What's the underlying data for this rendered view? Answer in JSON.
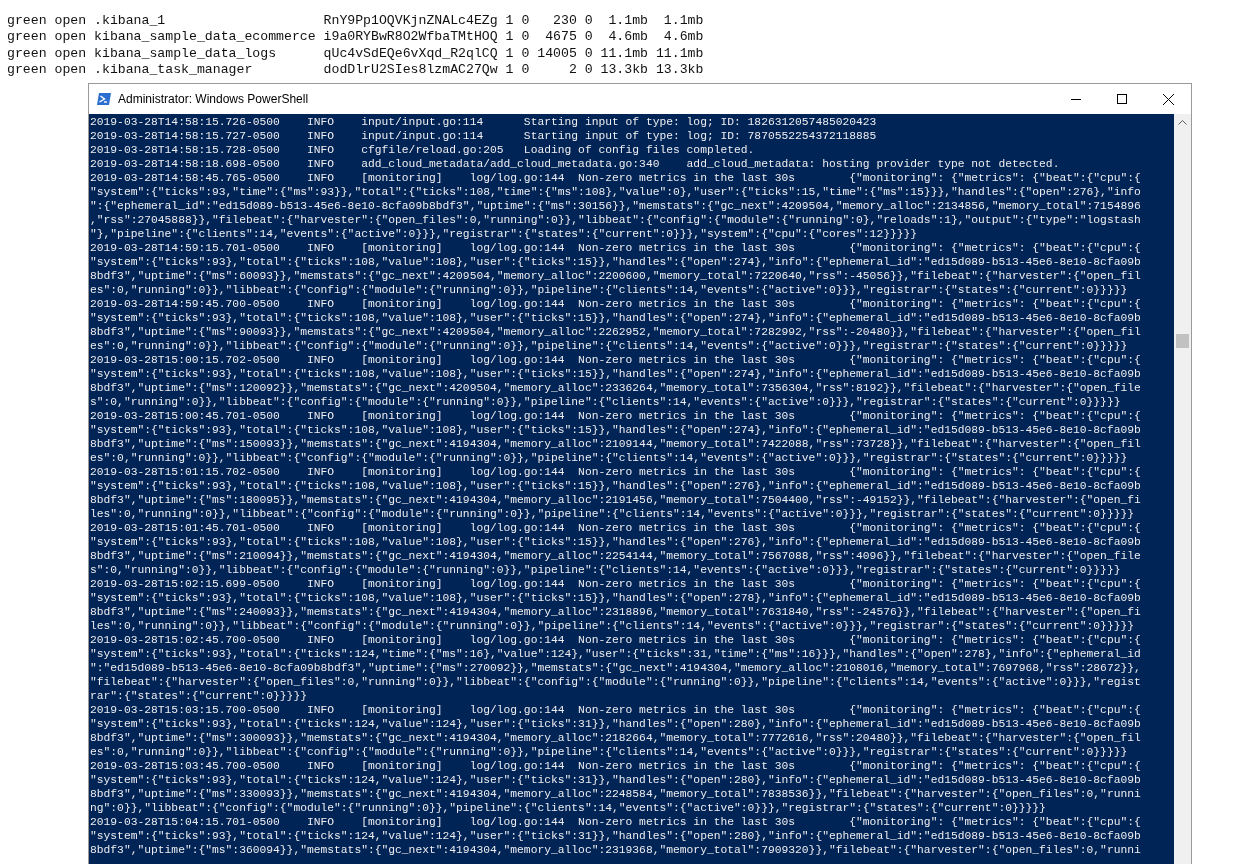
{
  "terminal_rows": [
    "green open .kibana_1                    RnY9Pp1OQVKjnZNALc4EZg 1 0   230 0  1.1mb  1.1mb",
    "green open kibana_sample_data_ecommerce i9a0RYBwR8O2WfbaTMtHOQ 1 0  4675 0  4.6mb  4.6mb",
    "green open kibana_sample_data_logs      qUc4vSdEQe6vXqd_R2qlCQ 1 0 14005 0 11.1mb 11.1mb",
    "green open .kibana_task_manager         dodDlrU2SIes8lzmAC27Qw 1 0     2 0 13.3kb 13.3kb"
  ],
  "window": {
    "title": "Administrator: Windows PowerShell"
  },
  "console_lines": [
    "2019-03-28T14:58:15.726-0500    INFO    input/input.go:114      Starting input of type: log; ID: 1826312057485020423",
    "2019-03-28T14:58:15.727-0500    INFO    input/input.go:114      Starting input of type: log; ID: 7870552254372118885",
    "2019-03-28T14:58:15.728-0500    INFO    cfgfile/reload.go:205   Loading of config files completed.",
    "2019-03-28T14:58:18.698-0500    INFO    add_cloud_metadata/add_cloud_metadata.go:340    add_cloud_metadata: hosting provider type not detected.",
    "2019-03-28T14:58:45.765-0500    INFO    [monitoring]    log/log.go:144  Non-zero metrics in the last 30s        {\"monitoring\": {\"metrics\": {\"beat\":{\"cpu\":{",
    "\"system\":{\"ticks\":93,\"time\":{\"ms\":93}},\"total\":{\"ticks\":108,\"time\":{\"ms\":108},\"value\":0},\"user\":{\"ticks\":15,\"time\":{\"ms\":15}}},\"handles\":{\"open\":276},\"info",
    "\":{\"ephemeral_id\":\"ed15d089-b513-45e6-8e10-8cfa09b8bdf3\",\"uptime\":{\"ms\":30156}},\"memstats\":{\"gc_next\":4209504,\"memory_alloc\":2134856,\"memory_total\":7154896",
    ",\"rss\":27045888}},\"filebeat\":{\"harvester\":{\"open_files\":0,\"running\":0}},\"libbeat\":{\"config\":{\"module\":{\"running\":0},\"reloads\":1},\"output\":{\"type\":\"logstash",
    "\"},\"pipeline\":{\"clients\":14,\"events\":{\"active\":0}}},\"registrar\":{\"states\":{\"current\":0}}},\"system\":{\"cpu\":{\"cores\":12}}}}}",
    "2019-03-28T14:59:15.701-0500    INFO    [monitoring]    log/log.go:144  Non-zero metrics in the last 30s        {\"monitoring\": {\"metrics\": {\"beat\":{\"cpu\":{",
    "\"system\":{\"ticks\":93},\"total\":{\"ticks\":108,\"value\":108},\"user\":{\"ticks\":15}},\"handles\":{\"open\":274},\"info\":{\"ephemeral_id\":\"ed15d089-b513-45e6-8e10-8cfa09b",
    "8bdf3\",\"uptime\":{\"ms\":60093}},\"memstats\":{\"gc_next\":4209504,\"memory_alloc\":2200600,\"memory_total\":7220640,\"rss\":-45056}},\"filebeat\":{\"harvester\":{\"open_fil",
    "es\":0,\"running\":0}},\"libbeat\":{\"config\":{\"module\":{\"running\":0}},\"pipeline\":{\"clients\":14,\"events\":{\"active\":0}}},\"registrar\":{\"states\":{\"current\":0}}}}}",
    "2019-03-28T14:59:45.700-0500    INFO    [monitoring]    log/log.go:144  Non-zero metrics in the last 30s        {\"monitoring\": {\"metrics\": {\"beat\":{\"cpu\":{",
    "\"system\":{\"ticks\":93},\"total\":{\"ticks\":108,\"value\":108},\"user\":{\"ticks\":15}},\"handles\":{\"open\":274},\"info\":{\"ephemeral_id\":\"ed15d089-b513-45e6-8e10-8cfa09b",
    "8bdf3\",\"uptime\":{\"ms\":90093}},\"memstats\":{\"gc_next\":4209504,\"memory_alloc\":2262952,\"memory_total\":7282992,\"rss\":-20480}},\"filebeat\":{\"harvester\":{\"open_fil",
    "es\":0,\"running\":0}},\"libbeat\":{\"config\":{\"module\":{\"running\":0}},\"pipeline\":{\"clients\":14,\"events\":{\"active\":0}}},\"registrar\":{\"states\":{\"current\":0}}}}}",
    "2019-03-28T15:00:15.702-0500    INFO    [monitoring]    log/log.go:144  Non-zero metrics in the last 30s        {\"monitoring\": {\"metrics\": {\"beat\":{\"cpu\":{",
    "\"system\":{\"ticks\":93},\"total\":{\"ticks\":108,\"value\":108},\"user\":{\"ticks\":15}},\"handles\":{\"open\":274},\"info\":{\"ephemeral_id\":\"ed15d089-b513-45e6-8e10-8cfa09b",
    "8bdf3\",\"uptime\":{\"ms\":120092}},\"memstats\":{\"gc_next\":4209504,\"memory_alloc\":2336264,\"memory_total\":7356304,\"rss\":8192}},\"filebeat\":{\"harvester\":{\"open_file",
    "s\":0,\"running\":0}},\"libbeat\":{\"config\":{\"module\":{\"running\":0}},\"pipeline\":{\"clients\":14,\"events\":{\"active\":0}}},\"registrar\":{\"states\":{\"current\":0}}}}}",
    "2019-03-28T15:00:45.701-0500    INFO    [monitoring]    log/log.go:144  Non-zero metrics in the last 30s        {\"monitoring\": {\"metrics\": {\"beat\":{\"cpu\":{",
    "\"system\":{\"ticks\":93},\"total\":{\"ticks\":108,\"value\":108},\"user\":{\"ticks\":15}},\"handles\":{\"open\":274},\"info\":{\"ephemeral_id\":\"ed15d089-b513-45e6-8e10-8cfa09b",
    "8bdf3\",\"uptime\":{\"ms\":150093}},\"memstats\":{\"gc_next\":4194304,\"memory_alloc\":2109144,\"memory_total\":7422088,\"rss\":73728}},\"filebeat\":{\"harvester\":{\"open_fil",
    "es\":0,\"running\":0}},\"libbeat\":{\"config\":{\"module\":{\"running\":0}},\"pipeline\":{\"clients\":14,\"events\":{\"active\":0}}},\"registrar\":{\"states\":{\"current\":0}}}}}",
    "2019-03-28T15:01:15.702-0500    INFO    [monitoring]    log/log.go:144  Non-zero metrics in the last 30s        {\"monitoring\": {\"metrics\": {\"beat\":{\"cpu\":{",
    "\"system\":{\"ticks\":93},\"total\":{\"ticks\":108,\"value\":108},\"user\":{\"ticks\":15}},\"handles\":{\"open\":276},\"info\":{\"ephemeral_id\":\"ed15d089-b513-45e6-8e10-8cfa09b",
    "8bdf3\",\"uptime\":{\"ms\":180095}},\"memstats\":{\"gc_next\":4194304,\"memory_alloc\":2191456,\"memory_total\":7504400,\"rss\":-49152}},\"filebeat\":{\"harvester\":{\"open_fi",
    "les\":0,\"running\":0}},\"libbeat\":{\"config\":{\"module\":{\"running\":0}},\"pipeline\":{\"clients\":14,\"events\":{\"active\":0}}},\"registrar\":{\"states\":{\"current\":0}}}}}",
    "2019-03-28T15:01:45.701-0500    INFO    [monitoring]    log/log.go:144  Non-zero metrics in the last 30s        {\"monitoring\": {\"metrics\": {\"beat\":{\"cpu\":{",
    "\"system\":{\"ticks\":93},\"total\":{\"ticks\":108,\"value\":108},\"user\":{\"ticks\":15}},\"handles\":{\"open\":276},\"info\":{\"ephemeral_id\":\"ed15d089-b513-45e6-8e10-8cfa09b",
    "8bdf3\",\"uptime\":{\"ms\":210094}},\"memstats\":{\"gc_next\":4194304,\"memory_alloc\":2254144,\"memory_total\":7567088,\"rss\":4096}},\"filebeat\":{\"harvester\":{\"open_file",
    "s\":0,\"running\":0}},\"libbeat\":{\"config\":{\"module\":{\"running\":0}},\"pipeline\":{\"clients\":14,\"events\":{\"active\":0}}},\"registrar\":{\"states\":{\"current\":0}}}}}",
    "2019-03-28T15:02:15.699-0500    INFO    [monitoring]    log/log.go:144  Non-zero metrics in the last 30s        {\"monitoring\": {\"metrics\": {\"beat\":{\"cpu\":{",
    "\"system\":{\"ticks\":93},\"total\":{\"ticks\":108,\"value\":108},\"user\":{\"ticks\":15}},\"handles\":{\"open\":278},\"info\":{\"ephemeral_id\":\"ed15d089-b513-45e6-8e10-8cfa09b",
    "8bdf3\",\"uptime\":{\"ms\":240093}},\"memstats\":{\"gc_next\":4194304,\"memory_alloc\":2318896,\"memory_total\":7631840,\"rss\":-24576}},\"filebeat\":{\"harvester\":{\"open_fi",
    "les\":0,\"running\":0}},\"libbeat\":{\"config\":{\"module\":{\"running\":0}},\"pipeline\":{\"clients\":14,\"events\":{\"active\":0}}},\"registrar\":{\"states\":{\"current\":0}}}}}",
    "2019-03-28T15:02:45.700-0500    INFO    [monitoring]    log/log.go:144  Non-zero metrics in the last 30s        {\"monitoring\": {\"metrics\": {\"beat\":{\"cpu\":{",
    "\"system\":{\"ticks\":93},\"total\":{\"ticks\":124,\"time\":{\"ms\":16},\"value\":124},\"user\":{\"ticks\":31,\"time\":{\"ms\":16}}},\"handles\":{\"open\":278},\"info\":{\"ephemeral_id",
    "\":\"ed15d089-b513-45e6-8e10-8cfa09b8bdf3\",\"uptime\":{\"ms\":270092}},\"memstats\":{\"gc_next\":4194304,\"memory_alloc\":2108016,\"memory_total\":7697968,\"rss\":28672}},",
    "\"filebeat\":{\"harvester\":{\"open_files\":0,\"running\":0}},\"libbeat\":{\"config\":{\"module\":{\"running\":0}},\"pipeline\":{\"clients\":14,\"events\":{\"active\":0}}},\"regist",
    "rar\":{\"states\":{\"current\":0}}}}}",
    "2019-03-28T15:03:15.700-0500    INFO    [monitoring]    log/log.go:144  Non-zero metrics in the last 30s        {\"monitoring\": {\"metrics\": {\"beat\":{\"cpu\":{",
    "\"system\":{\"ticks\":93},\"total\":{\"ticks\":124,\"value\":124},\"user\":{\"ticks\":31}},\"handles\":{\"open\":280},\"info\":{\"ephemeral_id\":\"ed15d089-b513-45e6-8e10-8cfa09b",
    "8bdf3\",\"uptime\":{\"ms\":300093}},\"memstats\":{\"gc_next\":4194304,\"memory_alloc\":2182664,\"memory_total\":7772616,\"rss\":20480}},\"filebeat\":{\"harvester\":{\"open_fil",
    "es\":0,\"running\":0}},\"libbeat\":{\"config\":{\"module\":{\"running\":0}},\"pipeline\":{\"clients\":14,\"events\":{\"active\":0}}},\"registrar\":{\"states\":{\"current\":0}}}}}",
    "2019-03-28T15:03:45.700-0500    INFO    [monitoring]    log/log.go:144  Non-zero metrics in the last 30s        {\"monitoring\": {\"metrics\": {\"beat\":{\"cpu\":{",
    "\"system\":{\"ticks\":93},\"total\":{\"ticks\":124,\"value\":124},\"user\":{\"ticks\":31}},\"handles\":{\"open\":280},\"info\":{\"ephemeral_id\":\"ed15d089-b513-45e6-8e10-8cfa09b",
    "8bdf3\",\"uptime\":{\"ms\":330093}},\"memstats\":{\"gc_next\":4194304,\"memory_alloc\":2248584,\"memory_total\":7838536}},\"filebeat\":{\"harvester\":{\"open_files\":0,\"runni",
    "ng\":0}},\"libbeat\":{\"config\":{\"module\":{\"running\":0}},\"pipeline\":{\"clients\":14,\"events\":{\"active\":0}}},\"registrar\":{\"states\":{\"current\":0}}}}}",
    "2019-03-28T15:04:15.701-0500    INFO    [monitoring]    log/log.go:144  Non-zero metrics in the last 30s        {\"monitoring\": {\"metrics\": {\"beat\":{\"cpu\":{",
    "\"system\":{\"ticks\":93},\"total\":{\"ticks\":124,\"value\":124},\"user\":{\"ticks\":31}},\"handles\":{\"open\":280},\"info\":{\"ephemeral_id\":\"ed15d089-b513-45e6-8e10-8cfa09b",
    "8bdf3\",\"uptime\":{\"ms\":360094}},\"memstats\":{\"gc_next\":4194304,\"memory_alloc\":2319368,\"memory_total\":7909320}},\"filebeat\":{\"harvester\":{\"open_files\":0,\"runni"
  ]
}
